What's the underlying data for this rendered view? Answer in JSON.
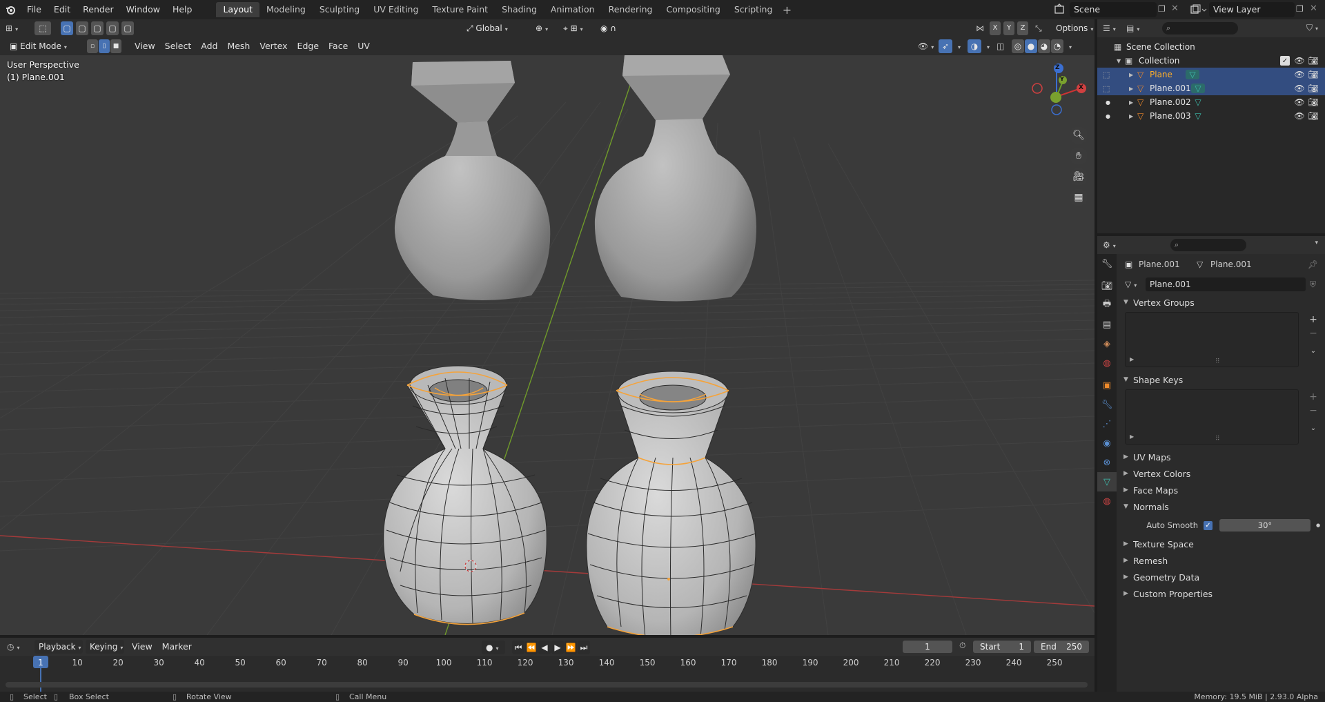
{
  "menu": {
    "items": [
      "File",
      "Edit",
      "Render",
      "Window",
      "Help"
    ]
  },
  "workspaces": {
    "tabs": [
      "Layout",
      "Modeling",
      "Sculpting",
      "UV Editing",
      "Texture Paint",
      "Shading",
      "Animation",
      "Rendering",
      "Compositing",
      "Scripting"
    ],
    "active": "Layout",
    "add": "+"
  },
  "scene": {
    "name": "Scene",
    "view_layer": "View Layer"
  },
  "viewport": {
    "mode": "Edit Mode",
    "menus": [
      "View",
      "Select",
      "Add",
      "Mesh",
      "Vertex",
      "Edge",
      "Face",
      "UV"
    ],
    "transform_orientation": "Global",
    "options": "Options",
    "axes": [
      "X",
      "Y",
      "Z"
    ],
    "overlay_title": "User Perspective",
    "overlay_object": "(1) Plane.001",
    "gizmo": {
      "x": "X",
      "y": "Y",
      "z": "Z"
    }
  },
  "outliner": {
    "scene_collection": "Scene Collection",
    "collection": "Collection",
    "objects": [
      {
        "name": "Plane",
        "active": true,
        "selected": true
      },
      {
        "name": "Plane.001",
        "active": false,
        "selected": true
      },
      {
        "name": "Plane.002",
        "active": false,
        "selected": false
      },
      {
        "name": "Plane.003",
        "active": false,
        "selected": false
      }
    ]
  },
  "properties": {
    "breadcrumb_object": "Plane.001",
    "breadcrumb_mesh": "Plane.001",
    "datablock_name": "Plane.001",
    "sections": {
      "vertex_groups": "Vertex Groups",
      "shape_keys": "Shape Keys",
      "uv_maps": "UV Maps",
      "vertex_colors": "Vertex Colors",
      "face_maps": "Face Maps",
      "normals": "Normals",
      "texture_space": "Texture Space",
      "remesh": "Remesh",
      "geometry_data": "Geometry Data",
      "custom_properties": "Custom Properties"
    },
    "auto_smooth_label": "Auto Smooth",
    "auto_smooth_angle": "30°"
  },
  "timeline": {
    "menus": [
      "Playback",
      "Keying",
      "View",
      "Marker"
    ],
    "current_frame": "1",
    "start_label": "Start",
    "start": "1",
    "end_label": "End",
    "end": "250",
    "ticks": [
      "1",
      "10",
      "20",
      "30",
      "40",
      "50",
      "60",
      "70",
      "80",
      "90",
      "100",
      "110",
      "120",
      "130",
      "140",
      "150",
      "160",
      "170",
      "180",
      "190",
      "200",
      "210",
      "220",
      "230",
      "240",
      "250"
    ]
  },
  "status": {
    "select": "Select",
    "box_select": "Box Select",
    "rotate_view": "Rotate View",
    "call_menu": "Call Menu",
    "memory": "Memory: 19.5 MiB | 2.93.0 Alpha"
  },
  "colors": {
    "accent_blue": "#4772b3",
    "active_orange": "#ffaf29",
    "selection_edge": "#f5a33a",
    "grid_red_axis": "#b84040",
    "grid_green_axis": "#7a9a30"
  }
}
